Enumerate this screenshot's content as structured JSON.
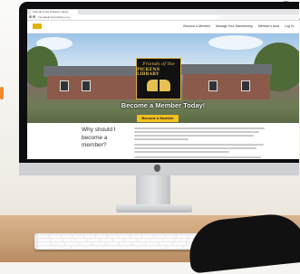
{
  "browser": {
    "tab_title": "Friends of the Pickens Library",
    "url": "friendsofpickenslibrary.org"
  },
  "site": {
    "nav": [
      "Become a Member",
      "Manage Your Membership",
      "Member's Area",
      "Log In"
    ],
    "hero": {
      "logo_line1": "Friends of the",
      "logo_line2": "PICKENS LIBRARY",
      "title": "Become a Member Today!",
      "cta_label": "Become a Member"
    },
    "content": {
      "heading": "Why should I become a member?"
    }
  },
  "colors": {
    "accent": "#f3c021",
    "logo_gold": "#e6c050",
    "logo_bg": "#111111"
  }
}
